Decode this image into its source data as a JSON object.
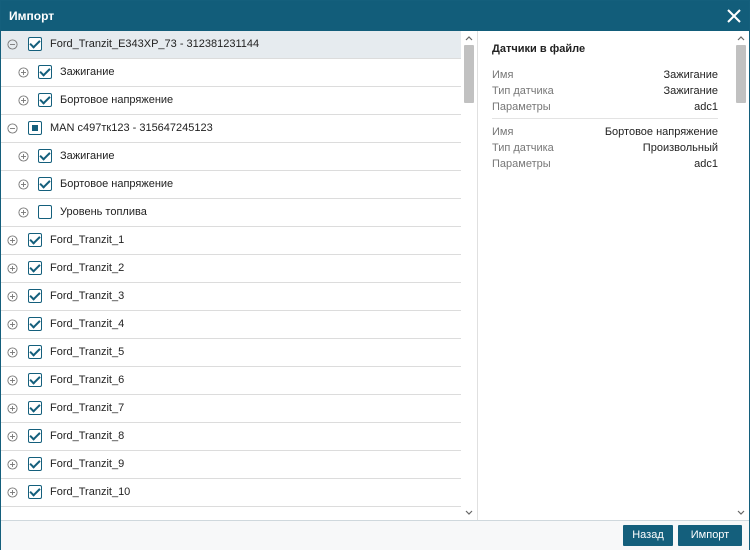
{
  "dialog": {
    "title": "Импорт"
  },
  "tree": {
    "rows": [
      {
        "level": 0,
        "state": "checked",
        "expanded": true,
        "selected": true,
        "label": "Ford_Tranzit_E343XP_73 - 312381231144"
      },
      {
        "level": 1,
        "state": "checked",
        "expanded": false,
        "label": "Зажигание"
      },
      {
        "level": 1,
        "state": "checked",
        "expanded": false,
        "label": "Бортовое напряжение"
      },
      {
        "level": 0,
        "state": "partial",
        "expanded": true,
        "label": "MAN с497тк123 - 315647245123"
      },
      {
        "level": 1,
        "state": "checked",
        "expanded": false,
        "label": "Зажигание"
      },
      {
        "level": 1,
        "state": "checked",
        "expanded": false,
        "label": "Бортовое напряжение"
      },
      {
        "level": 1,
        "state": "unchecked",
        "expanded": false,
        "label": "Уровень топлива"
      },
      {
        "level": 0,
        "state": "checked",
        "expanded": false,
        "label": "Ford_Tranzit_1"
      },
      {
        "level": 0,
        "state": "checked",
        "expanded": false,
        "label": "Ford_Tranzit_2"
      },
      {
        "level": 0,
        "state": "checked",
        "expanded": false,
        "label": "Ford_Tranzit_3"
      },
      {
        "level": 0,
        "state": "checked",
        "expanded": false,
        "label": "Ford_Tranzit_4"
      },
      {
        "level": 0,
        "state": "checked",
        "expanded": false,
        "label": "Ford_Tranzit_5"
      },
      {
        "level": 0,
        "state": "checked",
        "expanded": false,
        "label": "Ford_Tranzit_6"
      },
      {
        "level": 0,
        "state": "checked",
        "expanded": false,
        "label": "Ford_Tranzit_7"
      },
      {
        "level": 0,
        "state": "checked",
        "expanded": false,
        "label": "Ford_Tranzit_8"
      },
      {
        "level": 0,
        "state": "checked",
        "expanded": false,
        "label": "Ford_Tranzit_9"
      },
      {
        "level": 0,
        "state": "checked",
        "expanded": false,
        "label": "Ford_Tranzit_10"
      }
    ]
  },
  "details": {
    "heading": "Датчики в файле",
    "sensors": [
      {
        "props": [
          {
            "key": "Имя",
            "value": "Зажигание"
          },
          {
            "key": "Тип датчика",
            "value": "Зажигание"
          },
          {
            "key": "Параметры",
            "value": "adc1"
          }
        ]
      },
      {
        "props": [
          {
            "key": "Имя",
            "value": "Бортовое напряжение"
          },
          {
            "key": "Тип датчика",
            "value": "Произвольный"
          },
          {
            "key": "Параметры",
            "value": "adc1"
          }
        ]
      }
    ]
  },
  "footer": {
    "back_label": "Назад",
    "import_label": "Импорт"
  },
  "colors": {
    "accent": "#145f7c",
    "titlebar": "#125d7a",
    "selected_row": "#e6ebef",
    "scroll_thumb": "#c1c1c1"
  }
}
